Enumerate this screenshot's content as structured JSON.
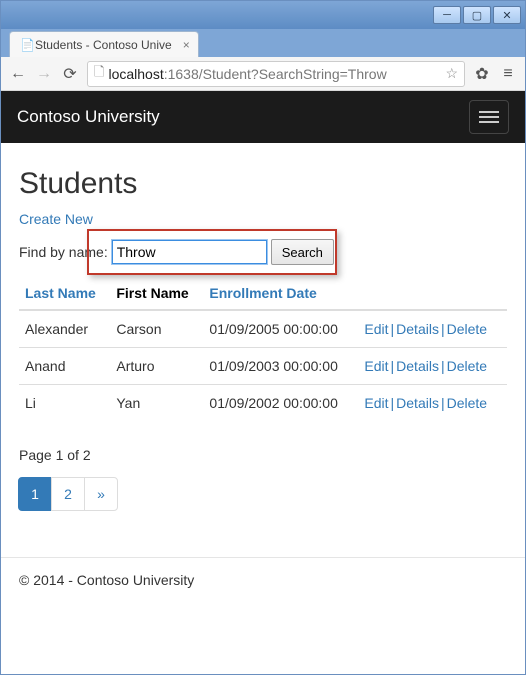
{
  "window": {
    "tab_title": "Students - Contoso Unive",
    "url_host": "localhost",
    "url_port": ":1638",
    "url_path": "/Student?SearchString=Throw"
  },
  "navbar": {
    "brand": "Contoso University"
  },
  "page": {
    "heading": "Students",
    "create_link": "Create New",
    "search_label": "Find by name:",
    "search_value": "Throw",
    "search_button": "Search"
  },
  "table": {
    "headers": {
      "last_name": "Last Name",
      "first_name": "First Name",
      "enroll_date": "Enrollment Date"
    },
    "action_labels": {
      "edit": "Edit",
      "details": "Details",
      "delete": "Delete"
    },
    "rows": [
      {
        "last": "Alexander",
        "first": "Carson",
        "date": "01/09/2005 00:00:00"
      },
      {
        "last": "Anand",
        "first": "Arturo",
        "date": "01/09/2003 00:00:00"
      },
      {
        "last": "Li",
        "first": "Yan",
        "date": "01/09/2002 00:00:00"
      }
    ]
  },
  "pager": {
    "summary": "Page 1 of 2",
    "pages": [
      "1",
      "2"
    ],
    "next_glyph": "»"
  },
  "footer": "© 2014 - Contoso University"
}
